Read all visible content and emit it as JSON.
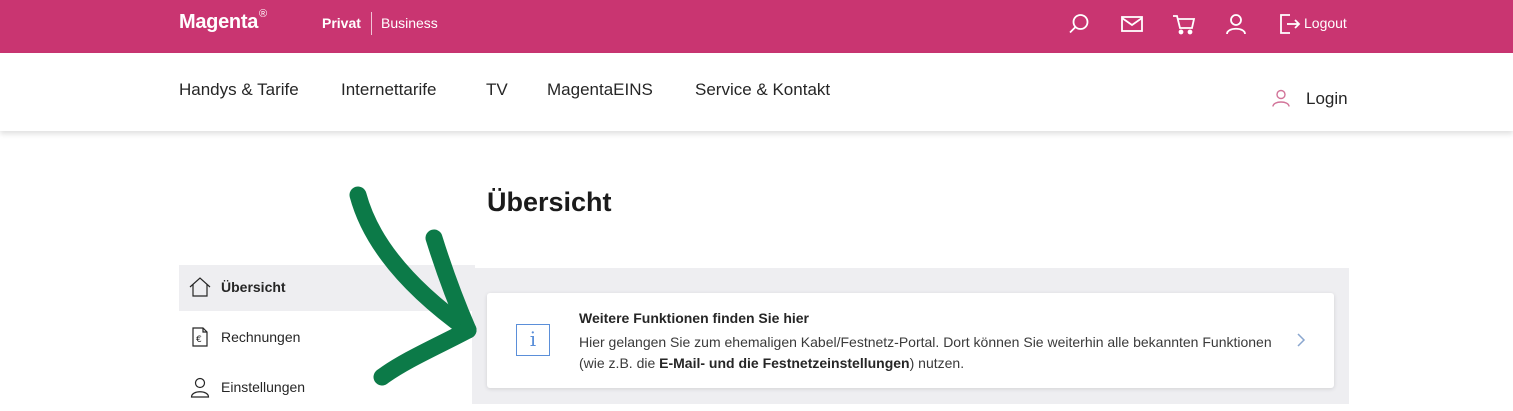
{
  "topbar": {
    "brand": "Magenta",
    "brand_mark": "®",
    "segments": {
      "privat": "Privat",
      "business": "Business"
    },
    "icons": [
      "search-icon",
      "mail-icon",
      "cart-icon",
      "user-icon",
      "logout-icon"
    ],
    "logout_label": "Logout",
    "color": "#c93571"
  },
  "nav": {
    "items": [
      "Handys & Tarife",
      "Internettarife",
      "TV",
      "MagentaEINS",
      "Service & Kontakt"
    ],
    "login_label": "Login"
  },
  "page": {
    "title": "Übersicht"
  },
  "sidebar": {
    "items": [
      {
        "label": "Übersicht",
        "icon": "home-icon",
        "active": true
      },
      {
        "label": "Rechnungen",
        "icon": "invoice-icon",
        "active": false
      },
      {
        "label": "Einstellungen",
        "icon": "user-icon",
        "active": false
      }
    ]
  },
  "info_card": {
    "icon": "info-icon",
    "title": "Weitere Funktionen finden Sie hier",
    "text_part1": "Hier gelangen Sie zum ehemaligen Kabel/Festnetz-Portal. Dort können Sie weiterhin alle bekannten Funktionen (wie z.B. die ",
    "text_bold": "E-Mail- und die Festnetzeinstellungen",
    "text_part2": ") nutzen.",
    "chevron": "chevron-right-icon"
  },
  "annotation": {
    "arrow_color": "#0c7a48"
  }
}
